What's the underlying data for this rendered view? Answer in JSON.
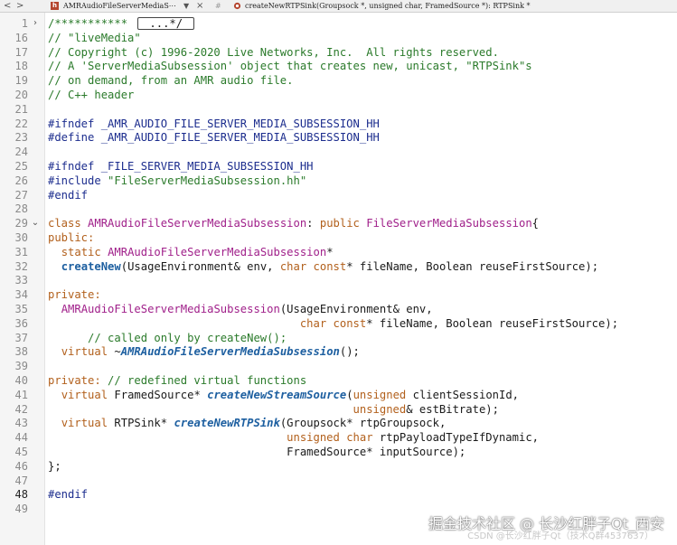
{
  "toolbar": {
    "back_label": "<",
    "forward_label": ">",
    "file_icon_letter": "h",
    "file_name": "AMRAudioFileServerMediaS⋯",
    "dropdown_label": "▼",
    "close_label": "×",
    "hash": "#",
    "function_path": "createNewRTPSink(Groupsock *, unsigned char, FramedSource *): RTPSink *"
  },
  "editor": {
    "lines": [
      {
        "no": "1",
        "fold": "›",
        "segs": [
          [
            "com",
            "/*********** "
          ],
          [
            "box",
            "...*/"
          ]
        ]
      },
      {
        "no": "16",
        "segs": [
          [
            "com",
            "// \"liveMedia\""
          ]
        ]
      },
      {
        "no": "17",
        "segs": [
          [
            "com",
            "// Copyright (c) 1996-2020 Live Networks, Inc.  All rights reserved."
          ]
        ]
      },
      {
        "no": "18",
        "segs": [
          [
            "com",
            "// A 'ServerMediaSubsession' object that creates new, unicast, \"RTPSink\"s"
          ]
        ]
      },
      {
        "no": "19",
        "segs": [
          [
            "com",
            "// on demand, from an AMR audio file."
          ]
        ]
      },
      {
        "no": "20",
        "segs": [
          [
            "com",
            "// C++ header"
          ]
        ]
      },
      {
        "no": "21",
        "segs": []
      },
      {
        "no": "22",
        "segs": [
          [
            "pp",
            "#ifndef _AMR_AUDIO_FILE_SERVER_MEDIA_SUBSESSION_HH"
          ]
        ]
      },
      {
        "no": "23",
        "segs": [
          [
            "pp",
            "#define _AMR_AUDIO_FILE_SERVER_MEDIA_SUBSESSION_HH"
          ]
        ]
      },
      {
        "no": "24",
        "segs": []
      },
      {
        "no": "25",
        "segs": [
          [
            "pp",
            "#ifndef _FILE_SERVER_MEDIA_SUBSESSION_HH"
          ]
        ]
      },
      {
        "no": "26",
        "segs": [
          [
            "pp",
            "#include "
          ],
          [
            "str",
            "\"FileServerMediaSubsession.hh\""
          ]
        ]
      },
      {
        "no": "27",
        "segs": [
          [
            "pp",
            "#endif"
          ]
        ]
      },
      {
        "no": "28",
        "segs": []
      },
      {
        "no": "29",
        "fold": "⌄",
        "segs": [
          [
            "kw",
            "class "
          ],
          [
            "cls",
            "AMRAudioFileServerMediaSubsession"
          ],
          [
            "pl",
            ": "
          ],
          [
            "kw",
            "public "
          ],
          [
            "cls",
            "FileServerMediaSubsession"
          ],
          [
            "pl",
            "{"
          ]
        ]
      },
      {
        "no": "30",
        "segs": [
          [
            "kw",
            "public:"
          ]
        ]
      },
      {
        "no": "31",
        "segs": [
          [
            "pl",
            "  "
          ],
          [
            "kw",
            "static "
          ],
          [
            "cls",
            "AMRAudioFileServerMediaSubsession"
          ],
          [
            "pl",
            "*"
          ]
        ]
      },
      {
        "no": "32",
        "segs": [
          [
            "pl",
            "  "
          ],
          [
            "fn",
            "createNew"
          ],
          [
            "pl",
            "(UsageEnvironment& env, "
          ],
          [
            "kw",
            "char const"
          ],
          [
            "pl",
            "* fileName, Boolean reuseFirstSource);"
          ]
        ]
      },
      {
        "no": "33",
        "segs": []
      },
      {
        "no": "34",
        "segs": [
          [
            "kw",
            "private:"
          ]
        ]
      },
      {
        "no": "35",
        "segs": [
          [
            "pl",
            "  "
          ],
          [
            "cls",
            "AMRAudioFileServerMediaSubsession"
          ],
          [
            "pl",
            "(UsageEnvironment& env,"
          ]
        ]
      },
      {
        "no": "36",
        "segs": [
          [
            "pl",
            "                                      "
          ],
          [
            "kw",
            "char const"
          ],
          [
            "pl",
            "* fileName, Boolean reuseFirstSource);"
          ]
        ]
      },
      {
        "no": "37",
        "segs": [
          [
            "pl",
            "      "
          ],
          [
            "com",
            "// called only by createNew();"
          ]
        ]
      },
      {
        "no": "38",
        "segs": [
          [
            "pl",
            "  "
          ],
          [
            "kw",
            "virtual "
          ],
          [
            "pl",
            "~"
          ],
          [
            "fni",
            "AMRAudioFileServerMediaSubsession"
          ],
          [
            "pl",
            "();"
          ]
        ]
      },
      {
        "no": "39",
        "segs": []
      },
      {
        "no": "40",
        "segs": [
          [
            "kw",
            "private: "
          ],
          [
            "com",
            "// redefined virtual functions"
          ]
        ]
      },
      {
        "no": "41",
        "segs": [
          [
            "pl",
            "  "
          ],
          [
            "kw",
            "virtual "
          ],
          [
            "pl",
            "FramedSource* "
          ],
          [
            "fni",
            "createNewStreamSource"
          ],
          [
            "pl",
            "("
          ],
          [
            "kw",
            "unsigned "
          ],
          [
            "pl",
            "clientSessionId,"
          ]
        ]
      },
      {
        "no": "42",
        "segs": [
          [
            "pl",
            "                                              "
          ],
          [
            "kw",
            "unsigned"
          ],
          [
            "pl",
            "& estBitrate);"
          ]
        ]
      },
      {
        "no": "43",
        "segs": [
          [
            "pl",
            "  "
          ],
          [
            "kw",
            "virtual "
          ],
          [
            "pl",
            "RTPSink* "
          ],
          [
            "fni",
            "createNewRTPSink"
          ],
          [
            "pl",
            "(Groupsock* rtpGroupsock,"
          ]
        ]
      },
      {
        "no": "44",
        "segs": [
          [
            "pl",
            "                                    "
          ],
          [
            "kw",
            "unsigned char "
          ],
          [
            "pl",
            "rtpPayloadTypeIfDynamic,"
          ]
        ]
      },
      {
        "no": "45",
        "segs": [
          [
            "pl",
            "                                    FramedSource* inputSource);"
          ]
        ]
      },
      {
        "no": "46",
        "segs": [
          [
            "pl",
            "};"
          ]
        ]
      },
      {
        "no": "47",
        "segs": []
      },
      {
        "no": "48",
        "cur": true,
        "segs": [
          [
            "pp",
            "#endif"
          ]
        ]
      },
      {
        "no": "49",
        "segs": []
      }
    ]
  },
  "watermark": {
    "main": "掘金技术社区 @ 长沙红胖子Qt_西安",
    "sub": "CSDN @长沙红胖子Qt（技术Q群4537637）"
  },
  "colors": {
    "comment": "#2a7a2a",
    "preprocessor": "#1c2d8e",
    "keyword": "#b2601c",
    "class": "#a0208a",
    "function": "#1d5fa0"
  }
}
